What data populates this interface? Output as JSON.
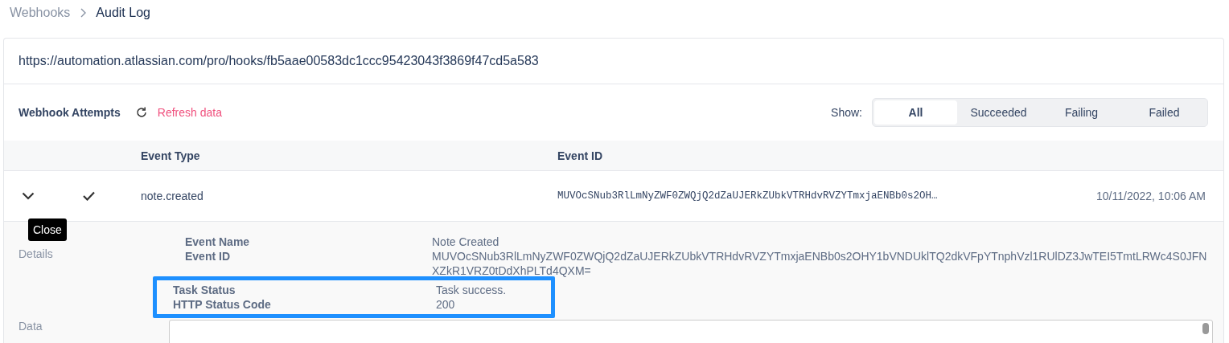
{
  "breadcrumb": [
    {
      "label": "Webhooks",
      "current": false
    },
    {
      "label": "Audit Log",
      "current": true
    }
  ],
  "url": "https://automation.atlassian.com/pro/hooks/fb5aae00583dc1ccc95423043f3869f47cd5a583",
  "toolbar": {
    "title": "Webhook Attempts",
    "refresh": "Refresh data",
    "show_label": "Show:"
  },
  "filters": [
    {
      "label": "All",
      "selected": true
    },
    {
      "label": "Succeeded",
      "selected": false
    },
    {
      "label": "Failing",
      "selected": false
    },
    {
      "label": "Failed",
      "selected": false
    }
  ],
  "table": {
    "columns": [
      "Event Type",
      "Event ID"
    ],
    "rows": [
      {
        "expanded": true,
        "succeeded": true,
        "event_type": "note.created",
        "event_id": "MUVOcSNub3RlLmNyZWF0ZWQjQ2dZaUJERkZUbkVTRHdvRVZYTmxjaENBb0s2OH…",
        "date": "10/11/2022, 10:06 AM"
      }
    ]
  },
  "tooltip": "Close",
  "details": {
    "label": "Details",
    "fields": [
      {
        "name": "Event Name",
        "value": "Note Created",
        "highlighted": false
      },
      {
        "name": "Event ID",
        "value": "MUVOcSNub3RlLmNyZWF0ZWQjQ2dZaUJERkZUbkVTRHdvRVZYTmxjaENBb0s2OHY1bVNDUklTQ2dkVFpYTnphVzl1RUlDZ3JwTEI5TmtLRWc4S0JFNXZkR1VRZ0tDdXhPLTd4QXM=",
        "highlighted": false
      },
      {
        "name": "Task Status",
        "value": "Task success.",
        "highlighted": true
      },
      {
        "name": "HTTP Status Code",
        "value": "200",
        "highlighted": true
      }
    ]
  },
  "data_label": "Data"
}
